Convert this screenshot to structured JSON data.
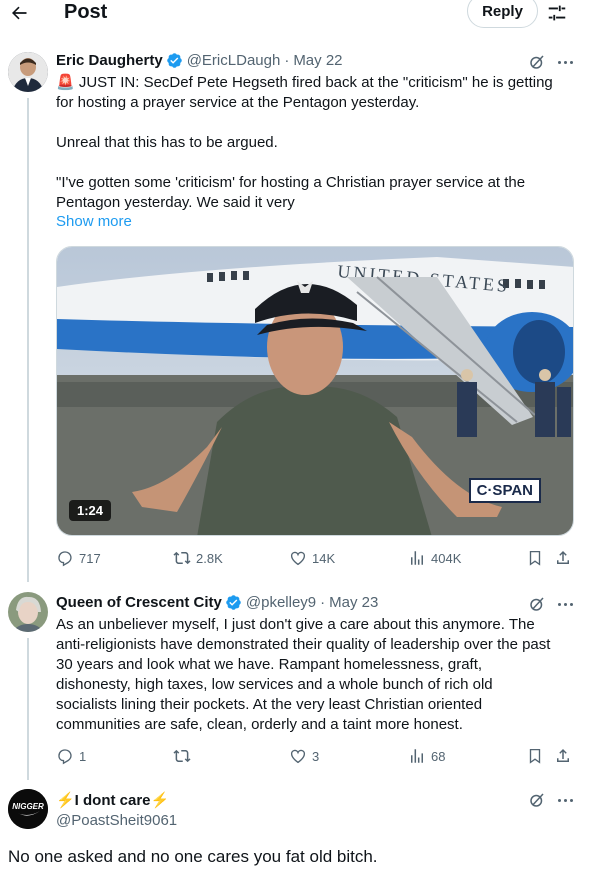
{
  "header": {
    "title": "Post",
    "reply_label": "Reply"
  },
  "tweets": [
    {
      "display_name": "Eric Daugherty",
      "handle": "@EricLDaugh",
      "date": "May 22",
      "verified": true,
      "text_lines": [
        "🚨 JUST IN: SecDef Pete Hegseth fired back at the \"criticism\" he is getting",
        "for hosting a prayer service at the Pentagon yesterday.",
        "",
        "Unreal that this has to be argued.",
        "",
        "\"I've gotten some 'criticism' for hosting a Christian prayer service at the",
        "Pentagon yesterday. We said it very"
      ],
      "show_more": "Show more",
      "video": {
        "duration": "1:24",
        "watermark": "C·SPAN",
        "plane_text": "UNITED STATES"
      },
      "stats": {
        "replies": "717",
        "reposts": "2.8K",
        "likes": "14K",
        "views": "404K"
      }
    },
    {
      "display_name": "Queen of Crescent City",
      "handle": "@pkelley9",
      "date": "May 23",
      "verified": true,
      "text_lines": [
        "As an unbeliever myself, I just don't give a care about this anymore.  The",
        "anti-religionists have demonstrated their quality of leadership over the past",
        "30 years and look what we have.  Rampant homelessness, graft,",
        "dishonesty, high taxes, low services and a whole bunch of rich old",
        "socialists lining their pockets.  At the very least Christian  oriented",
        "communities are safe, clean, orderly and a taint more honest."
      ],
      "stats": {
        "replies": "1",
        "reposts": "",
        "likes": "3",
        "views": "68"
      }
    },
    {
      "display_name": "⚡I dont care⚡",
      "handle": "@PoastSheit9061",
      "verified": false,
      "text": "No one asked and no one cares you fat old bitch.",
      "avatar_text": "NIGGER"
    }
  ],
  "colors": {
    "link_blue": "#1d9bf0",
    "secondary_text": "#536471",
    "verified_blue": "#1d9bf0"
  },
  "icons": [
    "back-arrow-icon",
    "filter-icon",
    "verified-icon",
    "grok-icon",
    "more-icon",
    "reply-icon",
    "repost-icon",
    "like-icon",
    "views-icon",
    "bookmark-icon",
    "share-icon"
  ]
}
